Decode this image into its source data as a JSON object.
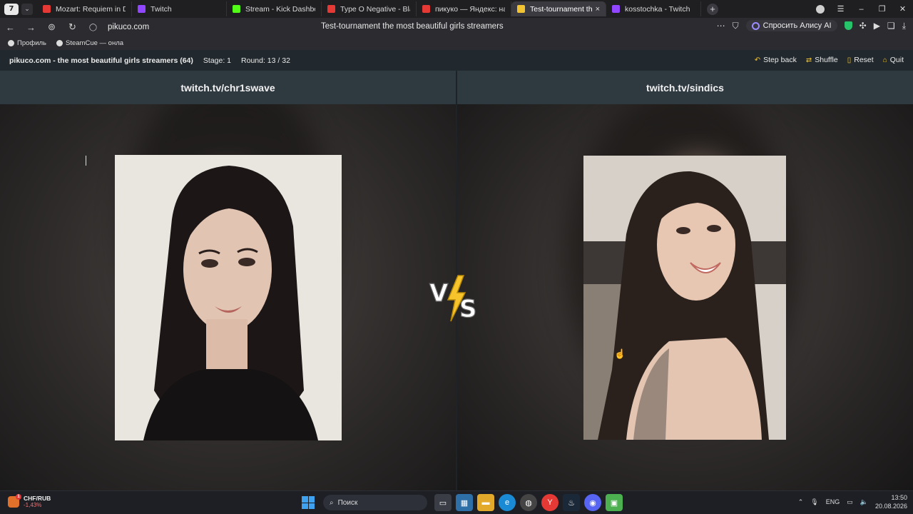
{
  "browser": {
    "workspace_badge": "7",
    "tabs": [
      {
        "label": "Mozart: Requiem in D Mino",
        "favicon": "youtube-icon",
        "color": "#e53935",
        "active": false
      },
      {
        "label": "Twitch",
        "favicon": "twitch-icon",
        "color": "#9146ff",
        "active": false
      },
      {
        "label": "Stream - Kick Dashboard",
        "favicon": "kick-icon",
        "color": "#53fc18",
        "active": false
      },
      {
        "label": "Type O Negative - Black N",
        "favicon": "youtube-icon",
        "color": "#e53935",
        "active": false
      },
      {
        "label": "пикуко — Яндекс: нашлось",
        "favicon": "yandex-icon",
        "color": "#e53935",
        "active": false
      },
      {
        "label": "Test-tournament the mo",
        "favicon": "pikuco-icon",
        "color": "#f1c232",
        "active": true
      },
      {
        "label": "kosstochka - Twitch",
        "favicon": "twitch-icon",
        "color": "#9146ff",
        "active": false
      }
    ],
    "url": "pikuco.com",
    "page_title": "Test-tournament the most beautiful girls streamers",
    "alice_label": "Спросить Алису AI",
    "bookmarks": [
      {
        "label": "Профиль"
      },
      {
        "label": "SteamCue — онла"
      }
    ]
  },
  "site": {
    "title": "pikuco.com - the most beautiful girls streamers (64)",
    "stage": "Stage: 1",
    "round": "Round: 13 / 32",
    "actions": [
      {
        "label": "Step back",
        "icon": "undo-icon"
      },
      {
        "label": "Shuffle",
        "icon": "shuffle-icon"
      },
      {
        "label": "Reset",
        "icon": "trash-icon"
      },
      {
        "label": "Quit",
        "icon": "home-icon"
      }
    ],
    "left_name": "twitch.tv/chr1swave",
    "right_name": "twitch.tv/sindics",
    "vs_text_v": "V",
    "vs_text_s": "S"
  },
  "taskbar": {
    "ticker_name": "CHF/RUB",
    "ticker_change": "-1,43%",
    "ticker_badge": "1",
    "search_placeholder": "Поиск",
    "lang": "ENG",
    "time": "13:50",
    "date": "20.08.2026"
  }
}
